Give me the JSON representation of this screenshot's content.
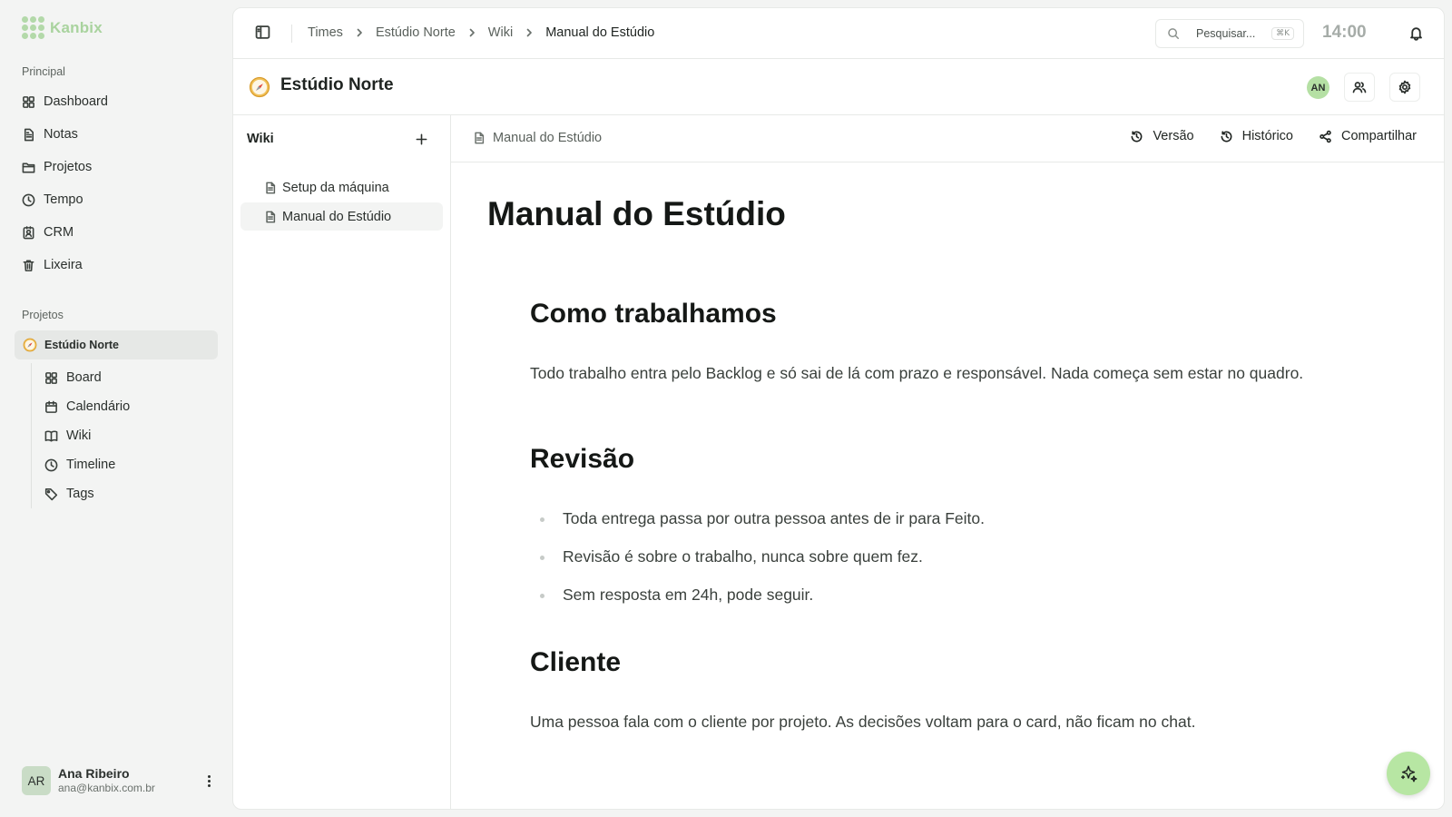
{
  "app": {
    "name": "Kanbix",
    "brand_color": "#a9d39e",
    "accent_color": "#b7e6a3"
  },
  "sidebar": {
    "section_main": "Principal",
    "items": [
      {
        "label": "Dashboard",
        "icon": "grid-icon"
      },
      {
        "label": "Notas",
        "icon": "note-icon"
      },
      {
        "label": "Projetos",
        "icon": "folder-icon"
      },
      {
        "label": "Tempo",
        "icon": "clock-icon"
      },
      {
        "label": "CRM",
        "icon": "contact-icon"
      },
      {
        "label": "Lixeira",
        "icon": "trash-icon"
      }
    ],
    "section_projects": "Projetos",
    "project": {
      "label": "Estúdio Norte",
      "icon": "compass-icon"
    },
    "project_items": [
      {
        "label": "Board",
        "icon": "grid-icon"
      },
      {
        "label": "Calendário",
        "icon": "calendar-icon"
      },
      {
        "label": "Wiki",
        "icon": "book-icon"
      },
      {
        "label": "Timeline",
        "icon": "clock-icon"
      },
      {
        "label": "Tags",
        "icon": "tag-icon"
      }
    ],
    "user": {
      "initials": "AR",
      "name": "Ana Ribeiro",
      "email": "ana@kanbix.com.br"
    }
  },
  "topbar": {
    "breadcrumb": [
      "Times",
      "Estúdio Norte",
      "Wiki",
      "Manual do Estúdio"
    ],
    "search_placeholder": "Pesquisar...",
    "search_shortcut": "⌘K",
    "time": "14:00"
  },
  "project_header": {
    "title": "Estúdio Norte",
    "member_initials": "AN"
  },
  "wiki": {
    "title": "Wiki",
    "pages": [
      {
        "label": "Setup da máquina",
        "active": false
      },
      {
        "label": "Manual do Estúdio",
        "active": true
      }
    ]
  },
  "document": {
    "breadcrumb": "Manual do Estúdio",
    "actions": {
      "version": "Versão",
      "history": "Histórico",
      "share": "Compartilhar"
    },
    "title": "Manual do Estúdio",
    "sections": [
      {
        "heading": "Como trabalhamos",
        "paragraph": "Todo trabalho entra pelo Backlog e só sai de lá com prazo e responsável. Nada começa sem estar no quadro."
      },
      {
        "heading": "Revisão",
        "bullets": [
          "Toda entrega passa por outra pessoa antes de ir para Feito.",
          "Revisão é sobre o trabalho, nunca sobre quem fez.",
          "Sem resposta em 24h, pode seguir."
        ]
      },
      {
        "heading": "Cliente",
        "paragraph": "Uma pessoa fala com o cliente por projeto. As decisões voltam para o card, não ficam no chat."
      }
    ]
  },
  "fab": {
    "icon": "sparkle-icon"
  }
}
